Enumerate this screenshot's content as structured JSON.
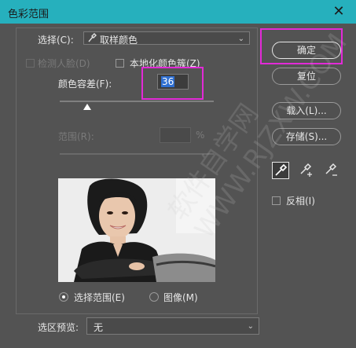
{
  "window": {
    "title": "色彩范围",
    "close_symbol": "✕"
  },
  "select": {
    "label": "选择(C):",
    "value": "取样颜色"
  },
  "detect_faces": {
    "label": "检测人脸(D)",
    "checked": false,
    "enabled": false
  },
  "localized_clusters": {
    "label": "本地化颜色簇(Z)",
    "checked": false
  },
  "fuzziness": {
    "label": "颜色容差(F):",
    "value": "36",
    "slider_fraction": 0.18
  },
  "range": {
    "label": "范围(R):",
    "value": "",
    "unit": "%"
  },
  "preview_mode": [
    {
      "label": "选择范围(E)",
      "selected": true
    },
    {
      "label": "图像(M)",
      "selected": false
    }
  ],
  "selection_preview": {
    "label": "选区预览:",
    "value": "无"
  },
  "buttons": {
    "ok": "确定",
    "reset": "复位",
    "load": "载入(L)...",
    "save": "存储(S)..."
  },
  "eyedroppers": [
    "eyedropper-tool",
    "add-to-sample-tool",
    "subtract-from-sample-tool"
  ],
  "invert": {
    "label": "反相(I)",
    "checked": false
  },
  "watermark": "软件自学网 WWW.RJZXW.COM",
  "colors": {
    "titlebar": "#26b0bd",
    "highlight": "#e22ad7",
    "bg": "#535353"
  }
}
